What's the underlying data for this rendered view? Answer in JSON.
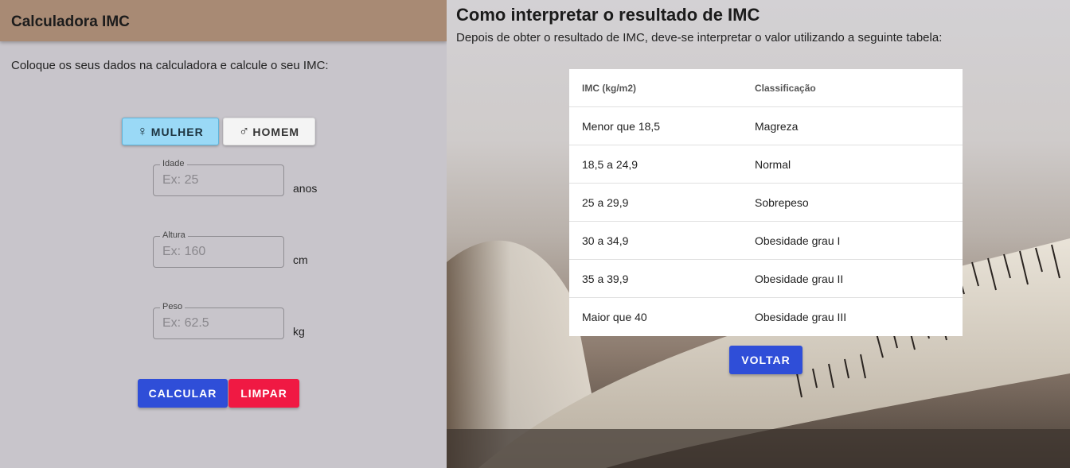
{
  "calculator": {
    "title": "Calculadora IMC",
    "intro": "Coloque os seus dados na calculadora e calcule o seu IMC:",
    "gender": {
      "female_label": "MULHER",
      "male_label": "HOMEM",
      "female_symbol": "♀",
      "male_symbol": "♂",
      "selected": "MULHER"
    },
    "fields": {
      "age": {
        "label": "Idade",
        "placeholder": "Ex: 25",
        "unit": "anos",
        "value": ""
      },
      "height": {
        "label": "Altura",
        "placeholder": "Ex: 160",
        "unit": "cm",
        "value": ""
      },
      "weight": {
        "label": "Peso",
        "placeholder": "Ex: 62.5",
        "unit": "kg",
        "value": ""
      }
    },
    "buttons": {
      "calculate": "CALCULAR",
      "clear": "LIMPAR"
    },
    "colors": {
      "header": "#a88a74",
      "primary": "#2f4ed8",
      "danger": "#f01943",
      "female_selected": "#9ad9f6"
    }
  },
  "interpretation": {
    "title": "Como interpretar o resultado de IMC",
    "subtitle": "Depois de obter o resultado de IMC, deve-se interpretar o valor utilizando a seguinte tabela:",
    "table": {
      "headers": [
        "IMC (kg/m2)",
        "Classificação"
      ],
      "rows": [
        [
          "Menor que 18,5",
          "Magreza"
        ],
        [
          "18,5 a 24,9",
          "Normal"
        ],
        [
          "25 a 29,9",
          "Sobrepeso"
        ],
        [
          "30 a 34,9",
          "Obesidade grau I"
        ],
        [
          "35 a 39,9",
          "Obesidade grau II"
        ],
        [
          "Maior que 40",
          "Obesidade grau III"
        ]
      ]
    },
    "back_button": "VOLTAR",
    "background_image": "measuring-tape"
  }
}
